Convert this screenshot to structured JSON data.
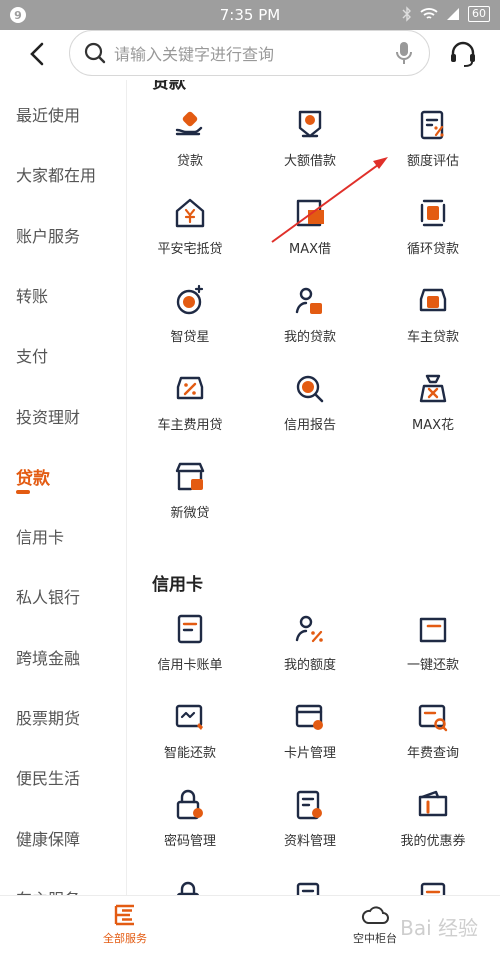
{
  "status": {
    "time": "7:35 PM",
    "notif": "9",
    "battery": "60"
  },
  "search": {
    "placeholder": "请输入关键字进行查询"
  },
  "sidebar": {
    "items": [
      {
        "label": "最近使用"
      },
      {
        "label": "大家都在用"
      },
      {
        "label": "账户服务"
      },
      {
        "label": "转账"
      },
      {
        "label": "支付"
      },
      {
        "label": "投资理财"
      },
      {
        "label": "贷款"
      },
      {
        "label": "信用卡"
      },
      {
        "label": "私人银行"
      },
      {
        "label": "跨境金融"
      },
      {
        "label": "股票期货"
      },
      {
        "label": "便民生活"
      },
      {
        "label": "健康保障"
      },
      {
        "label": "车主服务"
      }
    ],
    "active_index": 6
  },
  "loans": {
    "title": "贷款",
    "items": [
      {
        "label": "贷款",
        "icon": "hand-coin-icon"
      },
      {
        "label": "大额借款",
        "icon": "yen-tag-icon"
      },
      {
        "label": "额度评估",
        "icon": "percent-doc-icon"
      },
      {
        "label": "平安宅抵贷",
        "icon": "house-yen-icon"
      },
      {
        "label": "MAX借",
        "icon": "max-borrow-icon"
      },
      {
        "label": "循环贷款",
        "icon": "cycle-loan-icon"
      },
      {
        "label": "智贷星",
        "icon": "star-loan-icon"
      },
      {
        "label": "我的贷款",
        "icon": "user-loan-icon"
      },
      {
        "label": "车主贷款",
        "icon": "car-loan-icon"
      },
      {
        "label": "车主费用贷",
        "icon": "car-fee-icon"
      },
      {
        "label": "信用报告",
        "icon": "credit-report-icon"
      },
      {
        "label": "MAX花",
        "icon": "money-bag-icon"
      },
      {
        "label": "新微贷",
        "icon": "shop-loan-icon"
      }
    ]
  },
  "cards": {
    "title": "信用卡",
    "items": [
      {
        "label": "信用卡账单",
        "icon": "bill-icon"
      },
      {
        "label": "我的额度",
        "icon": "user-percent-icon"
      },
      {
        "label": "一键还款",
        "icon": "card-repay-icon"
      },
      {
        "label": "智能还款",
        "icon": "smart-repay-icon"
      },
      {
        "label": "卡片管理",
        "icon": "card-manage-icon"
      },
      {
        "label": "年费查询",
        "icon": "annual-fee-icon"
      },
      {
        "label": "密码管理",
        "icon": "lock-gear-icon"
      },
      {
        "label": "资料管理",
        "icon": "doc-gear-icon"
      },
      {
        "label": "我的优惠券",
        "icon": "wallet-icon"
      }
    ]
  },
  "tabs": [
    {
      "label": "全部服务",
      "active": true
    },
    {
      "label": "空中柜台",
      "active": false
    }
  ],
  "watermark": "Bai 经验",
  "colors": {
    "accent": "#e35b12",
    "icon_dark": "#1f2a44"
  }
}
